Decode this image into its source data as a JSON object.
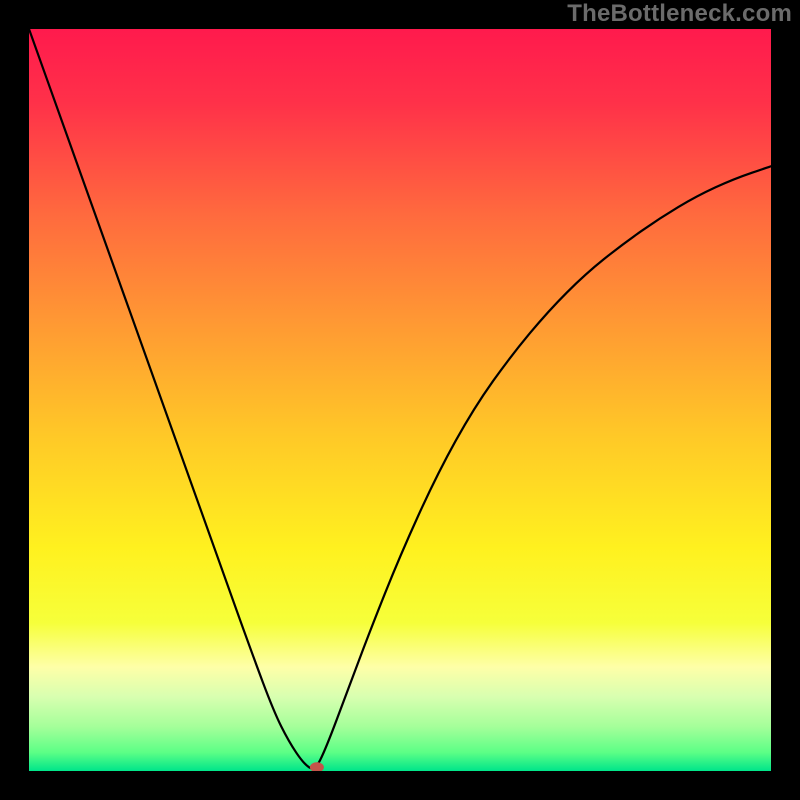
{
  "attribution": "TheBottleneck.com",
  "chart_data": {
    "type": "line",
    "title": "",
    "xlabel": "",
    "ylabel": "",
    "xlim": [
      0,
      100
    ],
    "ylim": [
      0,
      100
    ],
    "x": [
      0,
      5,
      10,
      15,
      20,
      25,
      30,
      33,
      35,
      37,
      38.5,
      40,
      43,
      46,
      50,
      55,
      60,
      65,
      70,
      75,
      80,
      85,
      90,
      95,
      100
    ],
    "values": [
      100,
      86,
      72,
      58,
      44,
      30,
      16,
      8,
      4,
      1,
      0,
      3,
      11,
      19,
      29,
      40,
      49,
      56,
      62,
      67,
      71,
      74.5,
      77.5,
      79.8,
      81.5
    ],
    "marker": {
      "x": 38.8,
      "y": 0.5
    },
    "gradient_stops": [
      {
        "offset": 0.0,
        "color": "#ff1a4d"
      },
      {
        "offset": 0.1,
        "color": "#ff3149"
      },
      {
        "offset": 0.25,
        "color": "#ff6a3e"
      },
      {
        "offset": 0.4,
        "color": "#ff9a33"
      },
      {
        "offset": 0.55,
        "color": "#ffc927"
      },
      {
        "offset": 0.7,
        "color": "#fff11f"
      },
      {
        "offset": 0.8,
        "color": "#f6ff3a"
      },
      {
        "offset": 0.86,
        "color": "#feffa8"
      },
      {
        "offset": 0.9,
        "color": "#d8ffb0"
      },
      {
        "offset": 0.94,
        "color": "#a5ff9a"
      },
      {
        "offset": 0.975,
        "color": "#5cff86"
      },
      {
        "offset": 1.0,
        "color": "#00e58a"
      }
    ]
  }
}
